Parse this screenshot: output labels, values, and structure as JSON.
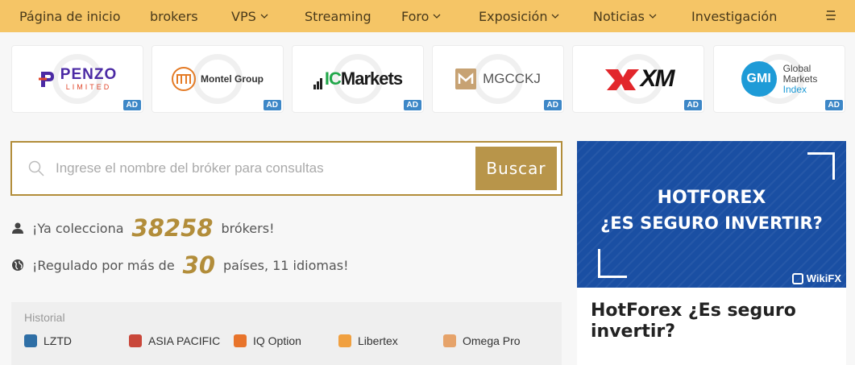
{
  "nav": {
    "items": [
      {
        "label": "Página de inicio",
        "dropdown": false
      },
      {
        "label": "brokers",
        "dropdown": false
      },
      {
        "label": "VPS",
        "dropdown": true
      },
      {
        "label": "Streaming",
        "dropdown": false
      },
      {
        "label": "Foro",
        "dropdown": true
      },
      {
        "label": "Exposición",
        "dropdown": true
      },
      {
        "label": "Noticias",
        "dropdown": true
      },
      {
        "label": "Investigación",
        "dropdown": false
      }
    ],
    "menu_icon": "hamburger-menu-icon",
    "bg_color": "#f5c566"
  },
  "brokers": [
    {
      "name": "PENZO",
      "sub": "LIMITED",
      "badge": "AD"
    },
    {
      "name": "Montel Group",
      "badge": "AD"
    },
    {
      "name_a": "IC",
      "name_b": "Markets",
      "badge": "AD"
    },
    {
      "name": "MGCCKJ",
      "badge": "AD"
    },
    {
      "name": "XM",
      "badge": "AD"
    },
    {
      "mark": "GMI",
      "line1": "Global",
      "line2": "Markets",
      "line3": "Index",
      "badge": "AD"
    }
  ],
  "search": {
    "placeholder": "Ingrese el nombre del bróker para consultas",
    "value": "",
    "button_label": "Buscar",
    "accent": "#b8954a"
  },
  "stats": {
    "collect_prefix": "¡Ya colecciona",
    "collect_count": "38258",
    "collect_suffix": "brókers!",
    "reg_prefix": "¡Regulado por más de",
    "reg_count": "30",
    "reg_suffix": "países, 11 idiomas!"
  },
  "history": {
    "title": "Historial",
    "items": [
      {
        "label": "LZTD",
        "color": "#2f6fa6"
      },
      {
        "label": "ASIA PACIFIC",
        "color": "#c9473a"
      },
      {
        "label": "IQ Option",
        "color": "#e8742b"
      },
      {
        "label": "Libertex",
        "color": "#f0a040"
      },
      {
        "label": "Omega Pro",
        "color": "#e6a36a"
      }
    ]
  },
  "banner": {
    "line1": "HOTFOREX",
    "line2": "¿ES SEGURO INVERTIR?",
    "brand": "WikiFX",
    "bg_color": "#1a4fa3"
  },
  "article": {
    "title": "HotForex ¿Es seguro invertir?"
  }
}
